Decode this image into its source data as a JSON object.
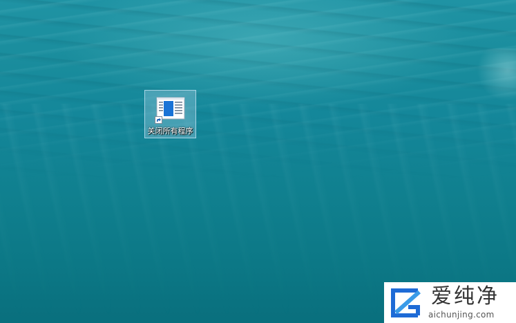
{
  "desktop": {
    "icons": [
      {
        "label": "关闭所有程序",
        "icon": "window-app-icon",
        "shortcut_overlay": "shortcut-arrow-icon",
        "selected": true
      }
    ]
  },
  "watermark": {
    "title": "爱纯净",
    "subtitle": "aichunjing.com",
    "logo": "aichunjing-logo"
  },
  "colors": {
    "water_top": "#1f93a4",
    "water_bottom": "#096f7d",
    "icon_blue": "#1a73d6",
    "logo_blue": "#1e6bd6",
    "selection": "#b4d7eb"
  }
}
